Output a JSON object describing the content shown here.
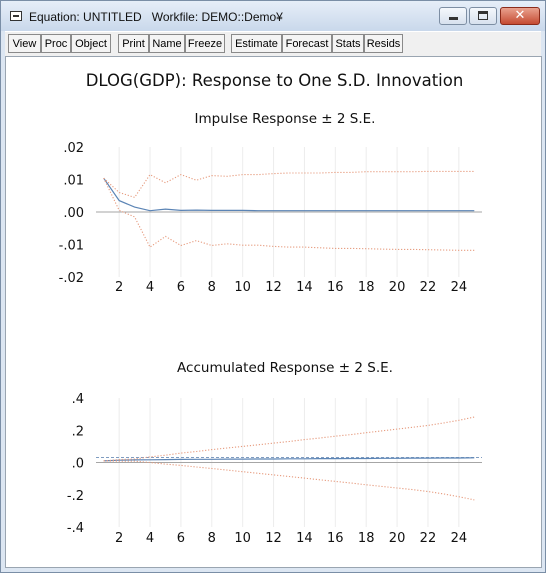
{
  "window": {
    "title": "Equation: UNTITLED   Workfile: DEMO::Demo¥",
    "minimize_label": "",
    "maximize_label": "",
    "close_label": "✕"
  },
  "toolbar": {
    "items": [
      "View",
      "Proc",
      "Object",
      "Print",
      "Name",
      "Freeze",
      "Estimate",
      "Forecast",
      "Stats",
      "Resids"
    ]
  },
  "figure": {
    "title": "DLOG(GDP): Response to One S.D. Innovation"
  },
  "colors": {
    "response_line": "#5b84b5",
    "se_band": "#e69a7d",
    "zero_line": "#a6a6a6",
    "grid": "#ececec",
    "dashed_ref": "#7f9cc0"
  },
  "chart_data": [
    {
      "type": "line",
      "title": "Impulse Response ± 2 S.E.",
      "xlabel": "",
      "ylabel": "",
      "x": [
        1,
        2,
        3,
        4,
        5,
        6,
        7,
        8,
        9,
        10,
        11,
        12,
        13,
        14,
        15,
        16,
        17,
        18,
        19,
        20,
        21,
        22,
        23,
        24,
        25
      ],
      "xlim": [
        0.5,
        25.5
      ],
      "ylim": [
        -0.02,
        0.02
      ],
      "x_ticks": [
        2,
        4,
        6,
        8,
        10,
        12,
        14,
        16,
        18,
        20,
        22,
        24
      ],
      "y_ticks": [
        0.02,
        0.01,
        0.0,
        -0.01,
        -0.02
      ],
      "y_tick_labels": [
        ".02",
        ".01",
        ".00",
        "-.01",
        "-.02"
      ],
      "grid": "vertical",
      "series": [
        {
          "style": "solid",
          "values": [
            0.0104,
            0.0035,
            0.0015,
            0.0004,
            0.0009,
            0.0005,
            0.0006,
            0.0005,
            0.0005,
            0.0005,
            0.0004,
            0.0004,
            0.0004,
            0.0004,
            0.0004,
            0.0004,
            0.0004,
            0.0004,
            0.0004,
            0.0004,
            0.0004,
            0.0004,
            0.0004,
            0.0004,
            0.0004
          ]
        },
        {
          "style": "dotted",
          "values": [
            0.0104,
            0.006,
            0.0045,
            0.0115,
            0.009,
            0.0115,
            0.0098,
            0.0112,
            0.011,
            0.0115,
            0.0115,
            0.0118,
            0.012,
            0.012,
            0.012,
            0.0122,
            0.0122,
            0.0124,
            0.0124,
            0.0124,
            0.0124,
            0.0125,
            0.0125,
            0.0125,
            0.0125
          ]
        },
        {
          "style": "dotted",
          "values": [
            0.0104,
            0.0005,
            -0.0015,
            -0.0108,
            -0.0075,
            -0.0103,
            -0.0088,
            -0.0103,
            -0.0098,
            -0.0102,
            -0.0102,
            -0.0106,
            -0.0108,
            -0.0108,
            -0.011,
            -0.0112,
            -0.0112,
            -0.0113,
            -0.0114,
            -0.0115,
            -0.0115,
            -0.0116,
            -0.0117,
            -0.0118,
            -0.0118
          ]
        }
      ]
    },
    {
      "type": "line",
      "title": "Accumulated Response ± 2 S.E.",
      "xlabel": "",
      "ylabel": "",
      "x": [
        1,
        2,
        3,
        4,
        5,
        6,
        7,
        8,
        9,
        10,
        11,
        12,
        13,
        14,
        15,
        16,
        17,
        18,
        19,
        20,
        21,
        22,
        23,
        24,
        25
      ],
      "xlim": [
        0.5,
        25.5
      ],
      "ylim": [
        -0.4,
        0.4
      ],
      "x_ticks": [
        2,
        4,
        6,
        8,
        10,
        12,
        14,
        16,
        18,
        20,
        22,
        24
      ],
      "y_ticks": [
        0.4,
        0.2,
        0.0,
        -0.2,
        -0.4
      ],
      "y_tick_labels": [
        ".4",
        ".2",
        ".0",
        "-.2",
        "-.4"
      ],
      "grid": "vertical",
      "reference_line": 0.031,
      "series": [
        {
          "style": "solid",
          "values": [
            0.01,
            0.014,
            0.016,
            0.017,
            0.018,
            0.019,
            0.02,
            0.02,
            0.021,
            0.021,
            0.022,
            0.022,
            0.023,
            0.023,
            0.024,
            0.024,
            0.025,
            0.025,
            0.026,
            0.026,
            0.027,
            0.027,
            0.028,
            0.028,
            0.029
          ]
        },
        {
          "style": "dotted",
          "values": [
            0.01,
            0.018,
            0.022,
            0.035,
            0.045,
            0.058,
            0.068,
            0.08,
            0.09,
            0.1,
            0.11,
            0.12,
            0.13,
            0.142,
            0.152,
            0.163,
            0.173,
            0.185,
            0.196,
            0.207,
            0.218,
            0.23,
            0.245,
            0.262,
            0.282
          ]
        },
        {
          "style": "dotted",
          "values": [
            0.01,
            0.008,
            0.008,
            0.0,
            -0.01,
            -0.018,
            -0.028,
            -0.037,
            -0.047,
            -0.057,
            -0.067,
            -0.077,
            -0.087,
            -0.097,
            -0.107,
            -0.117,
            -0.127,
            -0.138,
            -0.148,
            -0.158,
            -0.168,
            -0.18,
            -0.195,
            -0.212,
            -0.232
          ]
        }
      ]
    }
  ]
}
